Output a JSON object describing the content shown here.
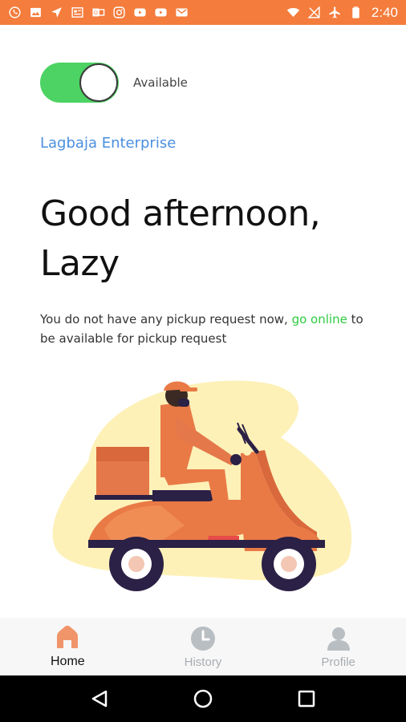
{
  "status_bar": {
    "time": "2:40",
    "left_icons": [
      "whatsapp-icon",
      "image-icon",
      "navigation-icon",
      "news-icon",
      "outlook-icon",
      "instagram-icon",
      "youtube-icon",
      "youtube-icon",
      "gmail-icon"
    ],
    "right_icons": [
      "wifi-icon",
      "no-signal-icon",
      "airplane-icon",
      "battery-icon"
    ]
  },
  "availability": {
    "label": "Available",
    "enabled": true
  },
  "company": "Lagbaja Enterprise",
  "greeting": {
    "line1": "Good afternoon,",
    "line2": "Lazy"
  },
  "message": {
    "before": "You do not have any pickup request now, ",
    "link": "go online",
    "after": " to be available for pickup request"
  },
  "bottom_nav": [
    {
      "label": "Home",
      "icon": "home-icon",
      "active": true
    },
    {
      "label": "History",
      "icon": "clock-icon",
      "active": false
    },
    {
      "label": "Profile",
      "icon": "user-icon",
      "active": false
    }
  ],
  "colors": {
    "accent": "#f47c3c",
    "toggle_on": "#4cd363",
    "company_link": "#4a8fe0",
    "online_link": "#2ecc40",
    "nav_inactive": "#a8adb2"
  }
}
